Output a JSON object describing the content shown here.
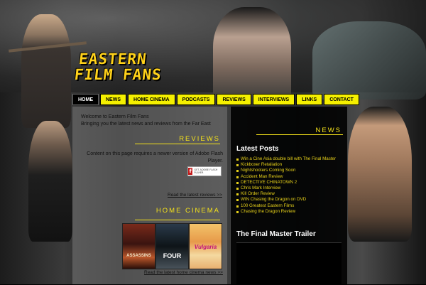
{
  "site": {
    "logo_line1": "EASTERN",
    "logo_line2": "FILM FANS"
  },
  "nav": [
    {
      "label": "HOME",
      "active": true
    },
    {
      "label": "NEWS"
    },
    {
      "label": "HOME CINEMA"
    },
    {
      "label": "PODCASTS"
    },
    {
      "label": "REVIEWS"
    },
    {
      "label": "INTERVIEWS"
    },
    {
      "label": "LINKS"
    },
    {
      "label": "CONTACT"
    }
  ],
  "intro": {
    "line1": "Welcome to Eastern Film Fans",
    "line2": "Bringing you the latest news and reviews from the Far East"
  },
  "reviews": {
    "title": "REVIEWS",
    "flash_message": "Content on this page requires a newer version of Adobe Flash Player.",
    "flash_button": "GET ADOBE FLASH PLAYER",
    "link": "Read the latest reviews >>"
  },
  "home_cinema": {
    "title": "HOME CINEMA",
    "dvds": [
      "ASSASSINS",
      "FOUR",
      "Vulgaria"
    ],
    "link": "Read the latest home cinema news >>"
  },
  "news": {
    "title": "NEWS",
    "latest_heading": "Latest Posts",
    "posts": [
      "Win a Cine Asia double bill with The Final Master",
      "Kickboxer Retaliation",
      "Nightshooters Coming Soon",
      "Accident Man Review",
      "DETECTIVE CHINATOWN 2",
      "Chris Mark Interview",
      "Kill Order Review",
      "WIN Chasing the Dragon on DVD",
      "100 Greatest Eastern Films",
      "Chasing the Dragon Review"
    ],
    "trailer_heading": "The Final Master Trailer"
  },
  "colors": {
    "accent": "#f5f000",
    "title_yellow": "#f5e21a"
  }
}
